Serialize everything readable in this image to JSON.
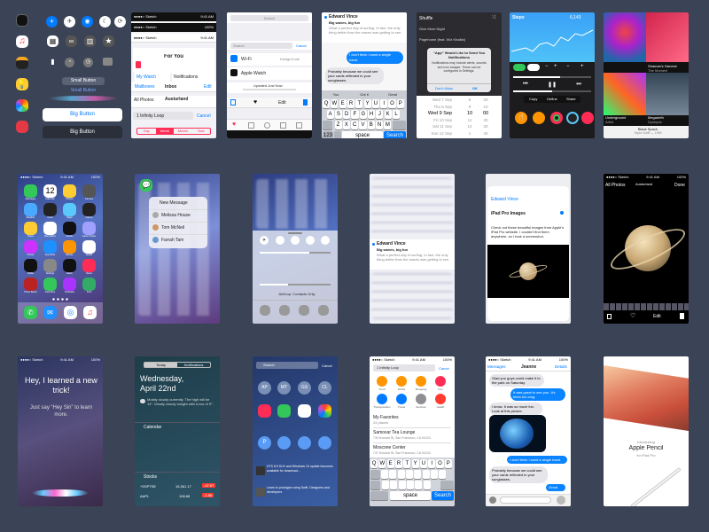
{
  "controls": {
    "small_button": "Small Button",
    "small_button_2": "Small Button",
    "big_button": "Big Button",
    "big_button_dark": "Big Button"
  },
  "music": {
    "title": "For You",
    "my_watch": "My Watch",
    "notifications": "Notifications",
    "mailboxes": "Mailboxes",
    "inbox": "Inbox",
    "edit": "Edit",
    "all_photos": "All Photos",
    "austurland": "Austurland",
    "search_val": "1 Infinity Loop",
    "cancel": "Cancel",
    "seg": [
      "Day",
      "Week",
      "Month",
      "Year"
    ]
  },
  "settings": {
    "search_placeholder": "Search",
    "cancel": "Cancel",
    "wifi": "Wi-Fi",
    "wifi_val": "DesignCode",
    "apple_watch": "Apple Watch",
    "updated": "Updated Just Now",
    "edit": "Edit"
  },
  "messages_top": {
    "sender": "Edward Vince",
    "subject": "Big waves, big fun",
    "snippet": "What a perfect day of surfing. In fact, the only thing better than the waves was getting to see",
    "reply": "I don't think I want a single hand.",
    "received": "Probably because we could see your cards reflected in your sunglasses.",
    "keys_row1": [
      "Q",
      "W",
      "E",
      "R",
      "T",
      "Y",
      "U",
      "I",
      "O",
      "P"
    ],
    "keys_row2": [
      "A",
      "S",
      "D",
      "F",
      "G",
      "H",
      "J",
      "K",
      "L"
    ],
    "keys_row3": [
      "Z",
      "X",
      "C",
      "V",
      "B",
      "N",
      "M"
    ],
    "k123": "123",
    "space": "space",
    "search": "Search",
    "suggest": [
      "You",
      "Got it",
      "Great"
    ]
  },
  "alert": {
    "shuffle": "Shuffle",
    "song1": "Give More Night",
    "song2": "Pagehome (feat. Wiz Khalifa)",
    "title": "“App” Would Like to Send You Notifications",
    "body": "Notifications may include alerts, sounds and icon badges. These can be configured in Settings.",
    "dont_allow": "Don't Allow",
    "ok": "OK",
    "picker": [
      [
        "Wed 7 Sep",
        "8",
        "00"
      ],
      [
        "Thu 8 Sep",
        "9",
        "10"
      ],
      [
        "Wed 9 Sep",
        "10",
        "00"
      ],
      [
        "Fri 10 Sep",
        "11",
        "20"
      ],
      [
        "Sat 11 Sep",
        "12",
        "30"
      ],
      [
        "Sun 12 Sep",
        "1",
        "40"
      ]
    ]
  },
  "health": {
    "steps": "Steps",
    "steps_val": "6,143",
    "sub": "steps",
    "copy": "Copy",
    "define": "Define",
    "share": "Share"
  },
  "albums": {
    "a1": "Shaman's Harvest",
    "a1s": "The Moment",
    "a2": "Underground",
    "a2s": "Artist",
    "a3": "Megadeth",
    "a3s": "Dystopia",
    "now": "Black Space",
    "now_s": "Taylor Swift — 1989"
  },
  "row2": {
    "new_message": "New Message",
    "melissa": "Melissa House",
    "tom": "Tom McNeil",
    "farrah": "Farrah Tam",
    "airdrop": "AirDrop: Contacts Only",
    "sender": "Edward Vince",
    "subject": "Big waves, big fun",
    "snippet": "What a perfect day of surfing. In fact, the only thing better than the waves was getting to see",
    "peek_sender": "Edward Vince",
    "peek_link": "iPad Pro Images",
    "peek_body": "Check out these beautiful images from Apple's iPad Pro website. I couldn't find them anywhere, so I took a screenshot.",
    "all_photos": "All Photos",
    "austurland": "Austurland",
    "done": "Done",
    "edit": "Edit",
    "app_labels": [
      "Messages",
      "Calendar",
      "Photos",
      "Camera",
      "Weather",
      "Clock",
      "Maps",
      "Videos",
      "Notes",
      "Reminders",
      "Stocks",
      "Game Center",
      "iTunes",
      "App Store",
      "iBooks",
      "Health",
      "Wallet",
      "Settings",
      "Watch",
      "News",
      "Photo Booth",
      "FaceTime",
      "Podcasts",
      "Find"
    ],
    "dock": [
      "Phone",
      "Mail",
      "Safari",
      "Music"
    ],
    "date": "12",
    "cal_day": "Monday"
  },
  "row3": {
    "siri_1": "Hey, I learned a new trick!",
    "siri_2": "Just say “Hey Siri” to learn more.",
    "today": "Today",
    "notif": "Notifications",
    "weekday": "Wednesday,",
    "date": "April 22nd",
    "forecast": "Mostly cloudy currently. The high will be 14°. Mostly cloudy tonight with a low of 9°.",
    "calendar": "Calendar",
    "stocks": "Stocks",
    "stock1": "^GSPTSE",
    "stock1_val": "15,361.17",
    "stock1_chg": "-47.67",
    "stock2": "AAPL",
    "stock2_val": "108.66",
    "stock2_chg": "-1.86",
    "search": "Search",
    "cancel": "Cancel",
    "spot_contacts": [
      "AP",
      "MT",
      "GS",
      "CL"
    ],
    "spot_names": [
      "Alexis",
      "Melissa",
      "Gary",
      "Carl"
    ],
    "news_1": "DTS 8.5 SUV and Windows 10 update becomes available for download...",
    "news_2": "Learn to prototype using Swift. Designers and developers",
    "maps_search": "1 Infinity Loop",
    "maps_cancel": "Cancel",
    "map_icons": [
      "Food",
      "Drinks",
      "Shopping",
      "Fun",
      "Transportation",
      "Travel",
      "Services",
      "Health"
    ],
    "fav": "My Favorites",
    "fav_sub": "24 places",
    "place1": "Samovar Tea Lounge",
    "place1_sub": "730 Howard St, San Francisco, CA 94103",
    "place2": "Moscone Center",
    "place2_sub": "747 Howard St, San Francisco, CA 94103",
    "keys_row1": [
      "Q",
      "W",
      "E",
      "R",
      "T",
      "Y",
      "U",
      "I",
      "O",
      "P"
    ],
    "space": "space",
    "search_key": "Search",
    "msg_back": "Messages",
    "msg_name": "Jeanne",
    "msg_details": "Details",
    "m1": "Glad you guys could make it to the park on Saturday.",
    "m2": "It was great to see you. It's been too long.",
    "m3": "I know. It was so much fun. Look at this picture.",
    "m4": "I don't think I want a single hand.",
    "m5": "Probably because we could see your cards reflected in your sunglasses.",
    "m6": "Great",
    "pencil_intro": "Introducing",
    "pencil_title": "Apple Pencil",
    "pencil_sub": "for iPad Pro"
  },
  "status": {
    "carrier": "●●●●○ Sketch",
    "time": "9:41 AM",
    "battery": "100%"
  },
  "colors": {
    "bg": "#3b4356",
    "blue": "#0a84ff",
    "pink": "#ff2d55",
    "red": "#ff3b30",
    "green": "#34c759",
    "orange": "#ff9500"
  }
}
